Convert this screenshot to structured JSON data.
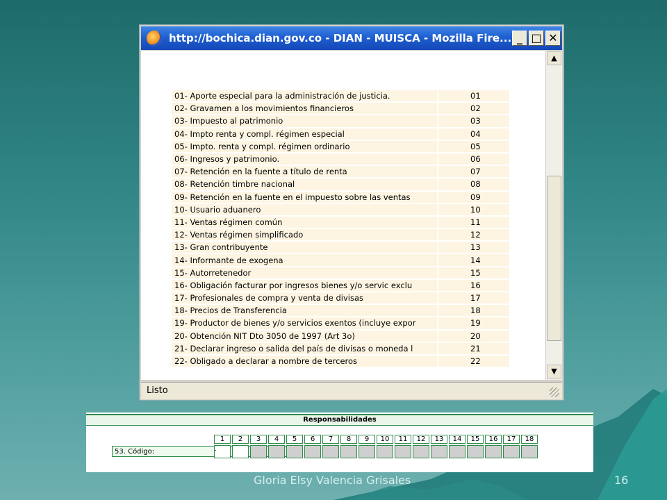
{
  "window": {
    "title": "http://bochica.dian.gov.co - DIAN - MUISCA - Mozilla Fire...",
    "buttons": {
      "minimize": "_",
      "maximize": "□",
      "close": "✕"
    },
    "status": "Listo"
  },
  "scrollbar": {
    "up": "▲",
    "down": "▼"
  },
  "responsabilidades": [
    {
      "label": "01- Aporte especial para la administración de justicia.",
      "code": "01"
    },
    {
      "label": "02- Gravamen a los movimientos financieros",
      "code": "02"
    },
    {
      "label": "03- Impuesto al patrimonio",
      "code": "03"
    },
    {
      "label": "04- Impto renta y compl. régimen especial",
      "code": "04"
    },
    {
      "label": "05- Impto. renta y compl. régimen ordinario",
      "code": "05"
    },
    {
      "label": "06- Ingresos y patrimonio.",
      "code": "06"
    },
    {
      "label": "07- Retención en la fuente a título de renta",
      "code": "07"
    },
    {
      "label": "08- Retención timbre nacional",
      "code": "08"
    },
    {
      "label": "09- Retención en la fuente en el impuesto sobre las ventas",
      "code": "09"
    },
    {
      "label": "10- Usuario aduanero",
      "code": "10"
    },
    {
      "label": "11- Ventas régimen común",
      "code": "11"
    },
    {
      "label": "12- Ventas régimen simplificado",
      "code": "12"
    },
    {
      "label": "13- Gran contribuyente",
      "code": "13"
    },
    {
      "label": "14- Informante de exogena",
      "code": "14"
    },
    {
      "label": "15- Autorretenedor",
      "code": "15"
    },
    {
      "label": "16- Obligación facturar por ingresos bienes y/o servic exclu",
      "code": "16"
    },
    {
      "label": "17- Profesionales de compra y venta de divisas",
      "code": "17"
    },
    {
      "label": "18- Precios de Transferencia",
      "code": "18"
    },
    {
      "label": "19- Productor de bienes y/o servicios exentos (incluye expor",
      "code": "19"
    },
    {
      "label": "20- Obtención NIT Dto 3050 de 1997 (Art 3o)",
      "code": "20"
    },
    {
      "label": "21- Declarar ingreso o salida del país de divisas o moneda l",
      "code": "21"
    },
    {
      "label": "22- Obligado a declarar a nombre de terceros",
      "code": "22"
    }
  ],
  "form": {
    "header": "Responsabilidades",
    "code_label": "53. Código:",
    "numbers": [
      "1",
      "2",
      "3",
      "4",
      "5",
      "6",
      "7",
      "8",
      "9",
      "10",
      "11",
      "12",
      "13",
      "14",
      "15",
      "16",
      "17",
      "18"
    ],
    "first_box_value": "."
  },
  "footer": {
    "author": "Gloria Elsy Valencia Grisales",
    "page": "16"
  }
}
